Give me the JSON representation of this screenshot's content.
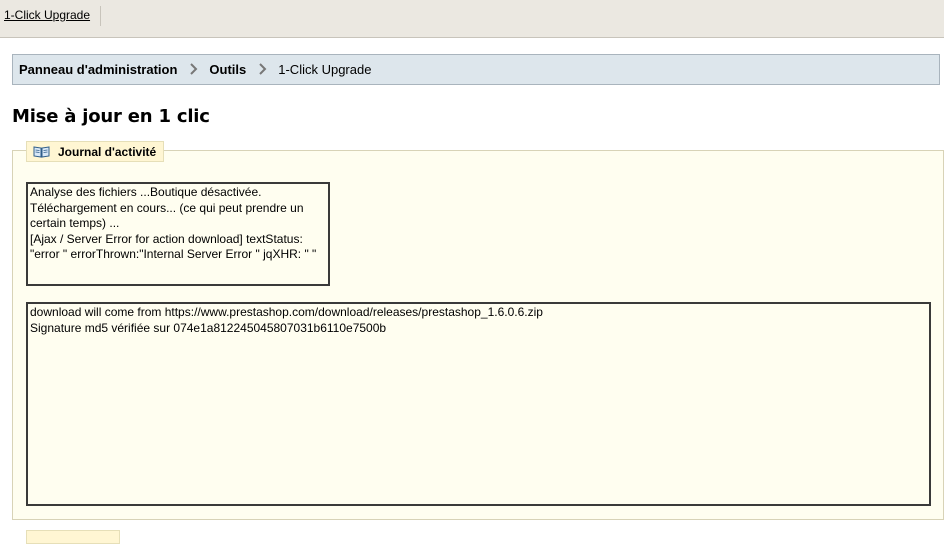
{
  "topbar": {
    "tab_label": "1-Click Upgrade"
  },
  "breadcrumb": {
    "items": [
      "Panneau d'administration",
      "Outils",
      "1-Click Upgrade"
    ],
    "separator": ">"
  },
  "page": {
    "title": "Mise à jour en 1 clic"
  },
  "activity": {
    "legend": "Journal d'activité",
    "icon": "book-icon",
    "status_lines": [
      "Analyse des fichiers ...Boutique désactivée.",
      "Téléchargement en cours... (ce qui peut prendre un certain temps) ...",
      "[Ajax / Server Error for action download] textStatus: \"error \" errorThrown:\"Internal Server Error \" jqXHR: \" \""
    ],
    "log_lines": [
      "download will come from https://www.prestashop.com/download/releases/prestashop_1.6.0.6.zip",
      "Signature md5 vérifiée sur 074e1a812245045807031b6110e7500b"
    ]
  },
  "colors": {
    "breadcrumb_bg": "#dde6ec",
    "panel_bg": "#fffef0",
    "legend_bg": "#fff6d3"
  }
}
